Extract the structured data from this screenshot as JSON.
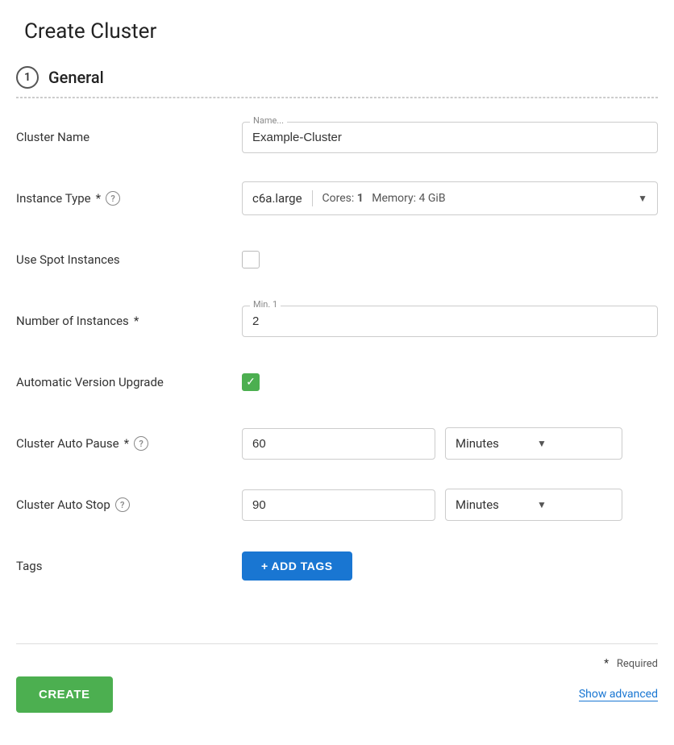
{
  "page": {
    "title": "Create Cluster"
  },
  "section": {
    "step": "1",
    "label": "General"
  },
  "form": {
    "cluster_name": {
      "label": "Cluster Name",
      "float_label": "Name...",
      "value": "Example-Cluster"
    },
    "instance_type": {
      "label": "Instance Type",
      "required": true,
      "value": "c6a.large",
      "cores_label": "Cores:",
      "cores_value": "1",
      "memory_label": "Memory:",
      "memory_value": "4 GiB"
    },
    "use_spot": {
      "label": "Use Spot Instances",
      "checked": false
    },
    "num_instances": {
      "label": "Number of Instances",
      "required": true,
      "float_label": "Min. 1",
      "value": "2"
    },
    "auto_version": {
      "label": "Automatic Version Upgrade",
      "checked": true,
      "check_symbol": "✓"
    },
    "auto_pause": {
      "label": "Cluster Auto Pause",
      "required": true,
      "value": "60",
      "unit": "Minutes"
    },
    "auto_stop": {
      "label": "Cluster Auto Stop",
      "value": "90",
      "unit": "Minutes"
    },
    "tags": {
      "label": "Tags",
      "add_button": "+ ADD TAGS"
    }
  },
  "footer": {
    "required_star": "*",
    "required_text": "Required",
    "create_button": "CREATE",
    "show_advanced": "Show advanced"
  }
}
